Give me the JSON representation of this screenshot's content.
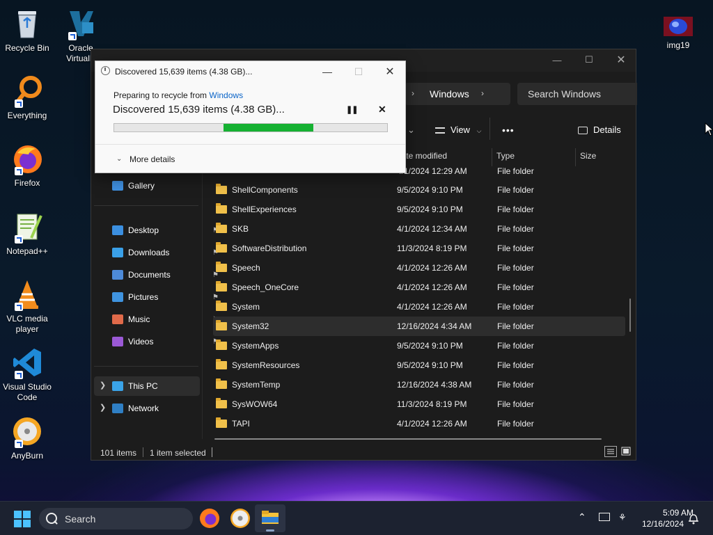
{
  "desktop": {
    "icons": [
      {
        "label": "Recycle Bin",
        "icon": "recycle-bin-icon"
      },
      {
        "label": "Oracle VirtualB",
        "icon": "virtualbox-icon"
      },
      {
        "label": "Everything",
        "icon": "everything-icon"
      },
      {
        "label": "Firefox",
        "icon": "firefox-icon"
      },
      {
        "label": "Notepad++",
        "icon": "notepadpp-icon"
      },
      {
        "label": "VLC media player",
        "icon": "vlc-icon"
      },
      {
        "label": "Visual Studio Code",
        "icon": "vscode-icon"
      },
      {
        "label": "AnyBurn",
        "icon": "anyburn-icon"
      },
      {
        "label": "img19",
        "icon": "image-file-icon"
      }
    ]
  },
  "explorer": {
    "breadcrumb": {
      "current": "Windows"
    },
    "search": {
      "placeholder": "Search Windows"
    },
    "toolbar": {
      "view_label": "View",
      "more_label": "•••",
      "details_label": "Details"
    },
    "columns": {
      "date": "Date modified",
      "type": "Type",
      "size": "Size"
    },
    "nav": {
      "gallery": "Gallery",
      "pinned": [
        {
          "label": "Desktop",
          "icon": "desktop-icon"
        },
        {
          "label": "Downloads",
          "icon": "downloads-icon"
        },
        {
          "label": "Documents",
          "icon": "documents-icon"
        },
        {
          "label": "Pictures",
          "icon": "pictures-icon"
        },
        {
          "label": "Music",
          "icon": "music-icon"
        },
        {
          "label": "Videos",
          "icon": "videos-icon"
        }
      ],
      "this_pc": "This PC",
      "network": "Network"
    },
    "files": [
      {
        "name": "",
        "date": "4/1/2024 12:29 AM",
        "type": "File folder"
      },
      {
        "name": "ShellComponents",
        "date": "9/5/2024 9:10 PM",
        "type": "File folder"
      },
      {
        "name": "ShellExperiences",
        "date": "9/5/2024 9:10 PM",
        "type": "File folder"
      },
      {
        "name": "SKB",
        "date": "4/1/2024 12:34 AM",
        "type": "File folder"
      },
      {
        "name": "SoftwareDistribution",
        "date": "11/3/2024 8:19 PM",
        "type": "File folder"
      },
      {
        "name": "Speech",
        "date": "4/1/2024 12:26 AM",
        "type": "File folder"
      },
      {
        "name": "Speech_OneCore",
        "date": "4/1/2024 12:26 AM",
        "type": "File folder"
      },
      {
        "name": "System",
        "date": "4/1/2024 12:26 AM",
        "type": "File folder"
      },
      {
        "name": "System32",
        "date": "12/16/2024 4:34 AM",
        "type": "File folder",
        "selected": true
      },
      {
        "name": "SystemApps",
        "date": "9/5/2024 9:10 PM",
        "type": "File folder"
      },
      {
        "name": "SystemResources",
        "date": "9/5/2024 9:10 PM",
        "type": "File folder"
      },
      {
        "name": "SystemTemp",
        "date": "12/16/2024 4:38 AM",
        "type": "File folder"
      },
      {
        "name": "SysWOW64",
        "date": "11/3/2024 8:19 PM",
        "type": "File folder"
      },
      {
        "name": "TAPI",
        "date": "4/1/2024 12:26 AM",
        "type": "File folder"
      }
    ],
    "status": {
      "count": "101 items",
      "selected": "1 item selected"
    }
  },
  "dialog": {
    "title": "Discovered 15,639 items (4.38 GB)...",
    "preparing_prefix": "Preparing to recycle from ",
    "preparing_link": "Windows",
    "heading": "Discovered 15,639 items (4.38 GB)...",
    "progress_fill_fraction": 0.33,
    "progress_fill_start_fraction": 0.4,
    "more_details": "More details"
  },
  "taskbar": {
    "search_label": "Search",
    "time": "5:09 AM",
    "date": "12/16/2024"
  },
  "colors": {
    "progress": "#16b132",
    "accent_link": "#0a64c8",
    "selection_row": "#2d2d2d"
  }
}
